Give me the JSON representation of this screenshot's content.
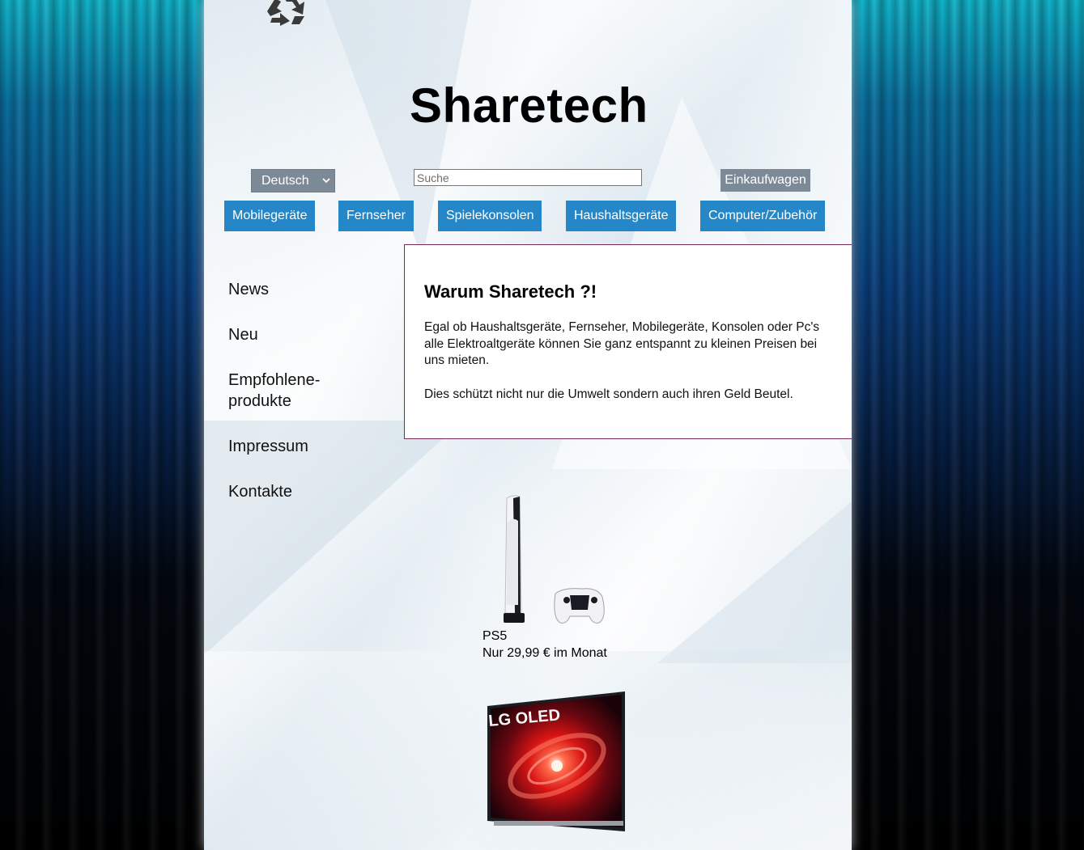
{
  "header": {
    "logo": "recycle-icon",
    "title": "Sharetech"
  },
  "toolbar": {
    "language": "Deutsch",
    "search_placeholder": "Suche",
    "cart_label": "Einkaufwagen"
  },
  "categories": [
    {
      "label": "Mobilegeräte"
    },
    {
      "label": "Fernseher"
    },
    {
      "label": "Spielekonsolen"
    },
    {
      "label": "Haushaltsgeräte"
    },
    {
      "label": "Computer/Zubehör"
    }
  ],
  "sidebar": {
    "items": [
      {
        "label": "News"
      },
      {
        "label": "Neu"
      },
      {
        "label": "Empfohlene-produkte"
      },
      {
        "label": "Impressum"
      },
      {
        "label": "Kontakte"
      }
    ]
  },
  "intro": {
    "title": "Warum Sharetech ?!",
    "paragraphs": [
      "Egal ob Haushaltsgeräte, Fernseher, Mobilegeräte, Konsolen oder Pc's alle Elektroaltgeräte können Sie ganz entspannt zu kleinen Preisen bei uns mieten.",
      "Dies schützt nicht nur die Umwelt sondern auch ihren Geld Beutel."
    ]
  },
  "products": [
    {
      "name": "PS5",
      "price": "Nur 29,99 € im Monat",
      "image": "ps5-console-image"
    },
    {
      "name": "",
      "price": "",
      "image": "lg-oled-tv-image",
      "image_text": "LG OLED"
    }
  ],
  "colors": {
    "category_button": "#2587c8",
    "gray_button": "#7b8a96",
    "info_border": "#7a2a55"
  }
}
